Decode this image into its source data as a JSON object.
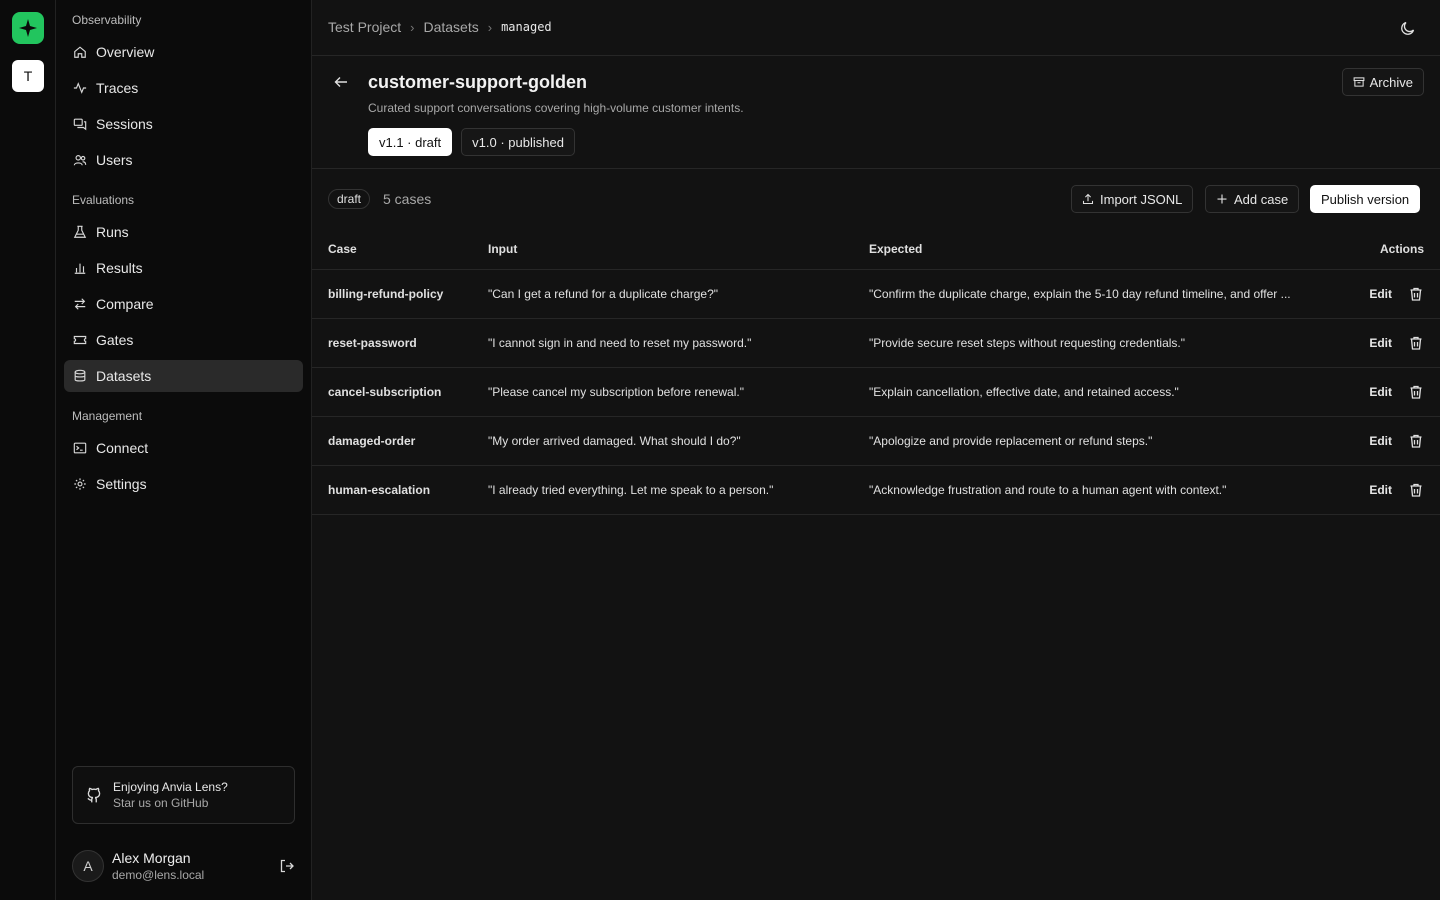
{
  "workspace": {
    "initial": "T"
  },
  "sidebar": {
    "sections": [
      {
        "title": "Observability"
      },
      {
        "title": "Evaluations"
      },
      {
        "title": "Management"
      }
    ],
    "items": [
      {
        "label": "Overview",
        "icon": "home-icon"
      },
      {
        "label": "Traces",
        "icon": "activity-icon"
      },
      {
        "label": "Sessions",
        "icon": "chat-icon"
      },
      {
        "label": "Users",
        "icon": "users-icon"
      },
      {
        "label": "Runs",
        "icon": "flask-icon"
      },
      {
        "label": "Results",
        "icon": "bar-chart-icon"
      },
      {
        "label": "Compare",
        "icon": "arrows-icon"
      },
      {
        "label": "Gates",
        "icon": "ticket-icon"
      },
      {
        "label": "Datasets",
        "icon": "database-icon",
        "active": true
      },
      {
        "label": "Connect",
        "icon": "terminal-icon"
      },
      {
        "label": "Settings",
        "icon": "gear-icon"
      }
    ],
    "promo": {
      "title": "Enjoying Anvia Lens?",
      "subtitle": "Star us on GitHub"
    },
    "user": {
      "initial": "A",
      "name": "Alex Morgan",
      "email": "demo@lens.local"
    }
  },
  "breadcrumb": {
    "project": "Test Project",
    "section": "Datasets",
    "current": "managed"
  },
  "dataset": {
    "name": "customer-support-golden",
    "description": "Curated support conversations covering high-volume customer intents.",
    "archive_label": "Archive",
    "versions": [
      {
        "label": "v1.1 · draft",
        "active": true
      },
      {
        "label": "v1.0 · published",
        "active": false
      }
    ]
  },
  "toolbar": {
    "status_badge": "draft",
    "case_count": "5 cases",
    "import_label": "Import JSONL",
    "add_label": "Add case",
    "publish_label": "Publish version"
  },
  "table": {
    "headers": {
      "case": "Case",
      "input": "Input",
      "expected": "Expected",
      "actions": "Actions"
    },
    "edit_label": "Edit",
    "rows": [
      {
        "case": "billing-refund-policy",
        "input": "\"Can I get a refund for a duplicate charge?\"",
        "expected": "\"Confirm the duplicate charge, explain the 5-10 day refund timeline, and offer ..."
      },
      {
        "case": "reset-password",
        "input": "\"I cannot sign in and need to reset my password.\"",
        "expected": "\"Provide secure reset steps without requesting credentials.\""
      },
      {
        "case": "cancel-subscription",
        "input": "\"Please cancel my subscription before renewal.\"",
        "expected": "\"Explain cancellation, effective date, and retained access.\""
      },
      {
        "case": "damaged-order",
        "input": "\"My order arrived damaged. What should I do?\"",
        "expected": "\"Apologize and provide replacement or refund steps.\""
      },
      {
        "case": "human-escalation",
        "input": "\"I already tried everything. Let me speak to a person.\"",
        "expected": "\"Acknowledge frustration and route to a human agent with context.\""
      }
    ]
  },
  "colors": {
    "brand": "#22c55e",
    "background": "#121212",
    "sidebar": "#0b0b0b",
    "active_nav": "#2a2a2a"
  }
}
